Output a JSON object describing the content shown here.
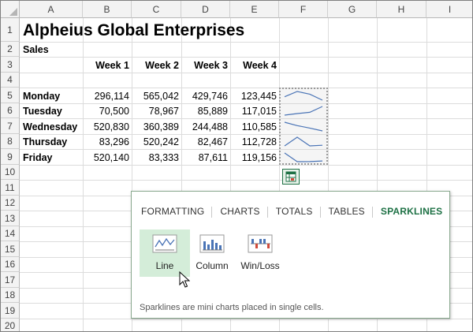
{
  "spreadsheet": {
    "columns": [
      "A",
      "B",
      "C",
      "D",
      "E",
      "F",
      "G",
      "H",
      "I"
    ],
    "rows": [
      "1",
      "2",
      "3",
      "4",
      "5",
      "6",
      "7",
      "8",
      "9",
      "10",
      "11",
      "12",
      "13",
      "14",
      "15",
      "16",
      "17",
      "18",
      "19",
      "20"
    ],
    "title": "Alpheius Global Enterprises",
    "subtitle": "Sales",
    "week_headers": [
      "Week 1",
      "Week 2",
      "Week 3",
      "Week 4"
    ],
    "data_rows": [
      {
        "day": "Monday",
        "values": [
          "296,114",
          "565,042",
          "429,746",
          "123,445"
        ]
      },
      {
        "day": "Tuesday",
        "values": [
          "70,500",
          "78,967",
          "85,889",
          "117,015"
        ]
      },
      {
        "day": "Wednesday",
        "values": [
          "520,830",
          "360,389",
          "244,488",
          "110,585"
        ]
      },
      {
        "day": "Thursday",
        "values": [
          "83,296",
          "520,242",
          "82,467",
          "112,728"
        ]
      },
      {
        "day": "Friday",
        "values": [
          "520,140",
          "83,333",
          "87,611",
          "119,156"
        ]
      }
    ],
    "sparkline_series": [
      [
        296114,
        565042,
        429746,
        123445
      ],
      [
        70500,
        78967,
        85889,
        117015
      ],
      [
        520830,
        360389,
        244488,
        110585
      ],
      [
        83296,
        520242,
        82467,
        112728
      ],
      [
        520140,
        83333,
        87611,
        119156
      ]
    ],
    "sparkline_color": "#4a74b6"
  },
  "quick_analysis": {
    "button_icon": "quick-analysis-icon",
    "tabs": [
      {
        "label": "FORMATTING",
        "active": false
      },
      {
        "label": "CHARTS",
        "active": false
      },
      {
        "label": "TOTALS",
        "active": false
      },
      {
        "label": "TABLES",
        "active": false
      },
      {
        "label": "SPARKLINES",
        "active": true
      }
    ],
    "options": [
      {
        "label": "Line",
        "icon": "line-sparkline-icon",
        "selected": true
      },
      {
        "label": "Column",
        "icon": "column-sparkline-icon",
        "selected": false
      },
      {
        "label": "Win/Loss",
        "icon": "winloss-sparkline-icon",
        "selected": false
      }
    ],
    "description": "Sparklines are mini charts placed in single cells.",
    "accent_color": "#1e7145"
  }
}
